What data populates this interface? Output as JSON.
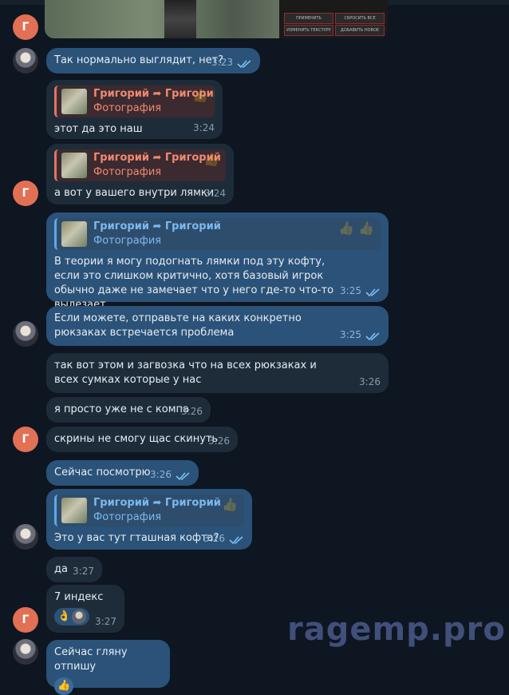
{
  "avatars": {
    "grigoriy_letter": "Г"
  },
  "screenshot": {
    "buttons": [
      "ПРИМЕНИТЬ",
      "СБРОСИТЬ ВСЕ",
      "ИЗМЕНИТЬ ТЕКСТУРУ",
      "ДОБАВИТЬ НОВОЕ"
    ]
  },
  "messages": [
    {
      "text": "Так нормально выглядит, нет?",
      "time": "3:23"
    },
    {
      "reply_name": "Григорий ➦ Григорий",
      "reply_sub": "Фотография",
      "text": "этот да это наш",
      "time": "3:24"
    },
    {
      "reply_name": "Григорий ➦ Григорий",
      "reply_sub": "Фотография",
      "text": "а вот у вашего внутри лямки",
      "time": "3:24"
    },
    {
      "reply_name": "Григорий ➦ Григорий",
      "reply_sub": "Фотография",
      "text": "В теории я могу подогнать лямки под эту кофту, если это слишком критично, хотя базовый игрок обычно даже не замечает что у него где-то что-то вылезает",
      "time": "3:25"
    },
    {
      "text": "Если можете, отправьте на каких конкретно рюкзаках встречается проблема",
      "time": "3:25"
    },
    {
      "text": "так вот этом и загвозка что на всех рюкзаках и всех сумках которые у нас",
      "time": "3:26"
    },
    {
      "text": "я просто уже не с компа",
      "time": "3:26"
    },
    {
      "text": "скрины не смогу щас скинуть",
      "time": "3:26"
    },
    {
      "text": "Сейчас посмотрю",
      "time": "3:26"
    },
    {
      "reply_name": "Григорий ➦ Григорий",
      "reply_sub": "Фотография",
      "text": "Это у вас тут гташная кофта?",
      "time": "3:26"
    },
    {
      "text": "да",
      "time": "3:27"
    },
    {
      "text": "7 индекс",
      "time": "3:27",
      "reaction": "👌"
    },
    {
      "text": "Сейчас гляну отпишу"
    }
  ],
  "watermark": "ragemp.pro",
  "colors": {
    "bg": "#0e1621",
    "incoming": "#1e2c3a",
    "outgoing": "#2b5278",
    "accent_red": "#e8735f",
    "accent_blue": "#63a7e8"
  }
}
